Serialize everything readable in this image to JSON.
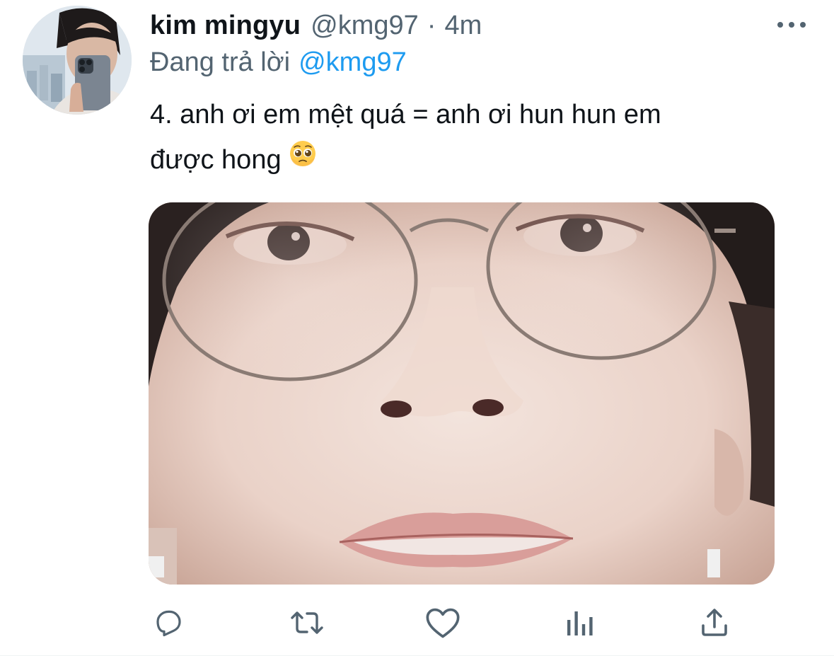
{
  "tweet": {
    "author": {
      "display_name": "kim mingyu",
      "handle": "@kmg97",
      "avatar": "avatar-photo"
    },
    "separator": "·",
    "time": "4m",
    "reply": {
      "prefix": "Đang trả lời",
      "mention": "@kmg97"
    },
    "text_lines": [
      "4. anh ơi em mệt quá = anh ơi hun hun em",
      "được hong"
    ],
    "emoji": "pleading-face-emoji",
    "media": {
      "type": "photo",
      "subject": "close-up face with round glasses"
    },
    "actions": [
      {
        "name": "reply",
        "icon": "reply-icon"
      },
      {
        "name": "retweet",
        "icon": "retweet-icon"
      },
      {
        "name": "like",
        "icon": "heart-icon"
      },
      {
        "name": "analytics",
        "icon": "analytics-icon"
      },
      {
        "name": "share",
        "icon": "share-icon"
      }
    ],
    "more_icon": "more-dots-icon"
  },
  "colors": {
    "text_primary": "#0f1419",
    "text_secondary": "#536471",
    "link": "#1d9bf0",
    "background": "#ffffff"
  }
}
